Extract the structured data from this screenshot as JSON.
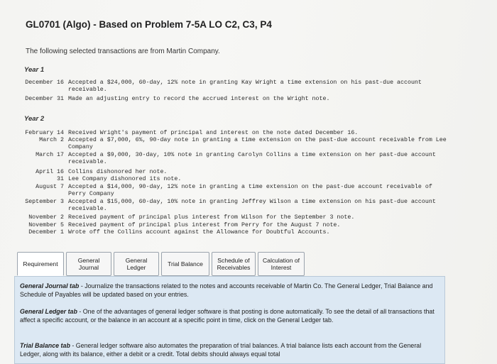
{
  "title": "GL0701 (Algo) - Based on Problem 7-5A LO C2, C3, P4",
  "intro": "The following selected transactions are from Martin Company.",
  "year1": {
    "label": "Year 1",
    "transactions": [
      {
        "date": "December 16",
        "text": "Accepted a $24,000, 60-day, 12% note in granting Kay Wright a time extension on his past-due account",
        "cont": "receivable."
      },
      {
        "date": "December 31",
        "text": "Made an adjusting entry to record the accrued interest on the Wright note.",
        "cont": ""
      }
    ]
  },
  "year2": {
    "label": "Year 2",
    "transactions": [
      {
        "date": "February 14",
        "text": "Received Wright's payment of principal and interest on the note dated December 16.",
        "cont": ""
      },
      {
        "date": "March 2",
        "text": "Accepted a $7,000, 6%, 90-day note in granting a time extension on the past-due account receivable from Lee",
        "cont": "Company"
      },
      {
        "date": "March 17",
        "text": "Accepted a $9,000, 30-day, 10% note in granting Carolyn Collins a time extension on her past-due account",
        "cont": "receivable."
      },
      {
        "date": "April 16",
        "text": "Collins dishonored her note.",
        "cont": ""
      },
      {
        "date": "31",
        "text": "Lee Company dishonored its note.",
        "cont": ""
      },
      {
        "date": "August 7",
        "text": "Accepted a $14,000, 90-day, 12% note in granting a time extension on the past-due account receivable of",
        "cont": "Perry Company"
      },
      {
        "date": "September 3",
        "text": "Accepted a $15,000, 60-day, 10% note in granting Jeffrey Wilson a time extension on his past-due account",
        "cont": "receivable."
      },
      {
        "date": "November 2",
        "text": "Received payment of principal plus interest from Wilson for the September 3 note.",
        "cont": ""
      },
      {
        "date": "November 5",
        "text": "Received payment of principal plus interest from Perry for the August 7 note.",
        "cont": ""
      },
      {
        "date": "December 1",
        "text": "Wrote off the Collins account against the Allowance for Doubtful Accounts.",
        "cont": ""
      }
    ]
  },
  "tabs": [
    {
      "line1": "Requirement",
      "line2": ""
    },
    {
      "line1": "General",
      "line2": "Journal"
    },
    {
      "line1": "General",
      "line2": "Ledger"
    },
    {
      "line1": "Trial Balance",
      "line2": ""
    },
    {
      "line1": "Schedule of",
      "line2": "Receivables"
    },
    {
      "line1": "Calculation of",
      "line2": "Interest"
    }
  ],
  "instructions": [
    {
      "heading": "General Journal tab",
      "body": " - Journalize the transactions related to the notes and accounts receivable of Martin Co. The General Ledger, Trial Balance and Schedule of Payables will be updated based on your entries."
    },
    {
      "heading": "General Ledger tab",
      "body": " - One of the advantages of general ledger software is that posting is done automatically. To see the detail of all transactions that affect a specific account, or the balance in an account at a specific point in time, click on the General Ledger tab."
    },
    {
      "heading": "Trial Balance tab",
      "body": " - General ledger software also automates the preparation of trial balances. A trial balance lists each account from the General Ledger, along with its balance, either a debit or a credit. Total debits should always equal total"
    }
  ]
}
